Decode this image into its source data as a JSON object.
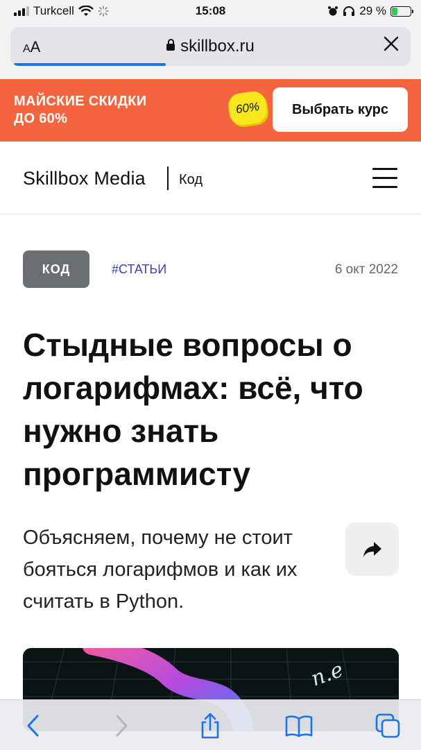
{
  "status_bar": {
    "carrier": "Turkcell",
    "time": "15:08",
    "battery_percent": "29 %",
    "battery_level": 0.29
  },
  "browser": {
    "aa_small": "A",
    "aa_large": "A",
    "url": "skillbox.ru",
    "load_progress": 0.38
  },
  "promo": {
    "line1": "МАЙСКИЕ СКИДКИ",
    "line2": "ДО 60%",
    "badge": "60%",
    "button": "Выбрать курс",
    "colors": {
      "background": "#f3643f",
      "badge": "#f8e71c"
    }
  },
  "header": {
    "logo": "Skillbox Media",
    "section": "Код"
  },
  "article": {
    "category": "КОД",
    "hashtag": "#СТАТЬИ",
    "date": "6 окт 2022",
    "title": "Стыдные вопросы о логарифмах: всё, что нужно знать программисту",
    "lead": "Объясняем, почему не стоит бояться логарифмов и как их считать в Python."
  },
  "toolbar": {
    "icons": [
      "back-icon",
      "forward-icon",
      "share-icon",
      "bookmarks-icon",
      "tabs-icon"
    ],
    "accent": "#1a73e8"
  }
}
